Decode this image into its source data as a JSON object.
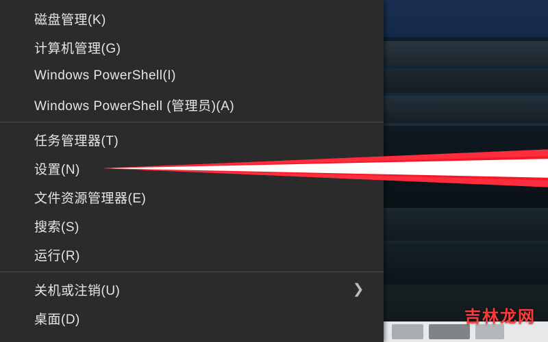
{
  "menu": {
    "groups": [
      {
        "items": [
          {
            "id": "disk-mgmt",
            "label": "磁盘管理(K)",
            "submenu": false
          },
          {
            "id": "comp-mgmt",
            "label": "计算机管理(G)",
            "submenu": false
          },
          {
            "id": "powershell",
            "label": "Windows PowerShell(I)",
            "submenu": false
          },
          {
            "id": "powershell-admin",
            "label": "Windows PowerShell (管理员)(A)",
            "submenu": false
          }
        ]
      },
      {
        "items": [
          {
            "id": "task-mgr",
            "label": "任务管理器(T)",
            "submenu": false
          },
          {
            "id": "settings",
            "label": "设置(N)",
            "submenu": false,
            "highlighted": true
          },
          {
            "id": "explorer",
            "label": "文件资源管理器(E)",
            "submenu": false
          },
          {
            "id": "search",
            "label": "搜索(S)",
            "submenu": false
          },
          {
            "id": "run",
            "label": "运行(R)",
            "submenu": false
          }
        ]
      },
      {
        "items": [
          {
            "id": "shutdown",
            "label": "关机或注销(U)",
            "submenu": true
          },
          {
            "id": "desktop",
            "label": "桌面(D)",
            "submenu": false
          }
        ]
      }
    ]
  },
  "annotation": {
    "arrow_target": "settings",
    "arrow_color": "#ff1a2a",
    "arrow_glow": "#ffffff"
  },
  "watermark": {
    "text": "吉林龙网"
  },
  "colors": {
    "menu_bg": "#2b2b2b",
    "menu_fg": "#e6e6e6",
    "separator": "#4a4a4a"
  }
}
